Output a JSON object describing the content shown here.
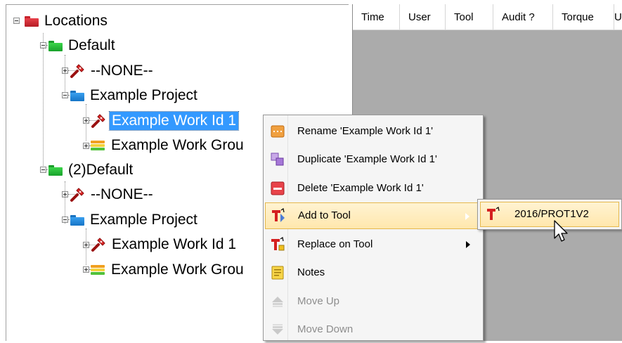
{
  "tree": {
    "root": {
      "label": "Locations",
      "icon": "folder-red"
    },
    "nodes": [
      {
        "label": "Default",
        "icon": "folder-green"
      },
      {
        "label": "--NONE--",
        "icon": "tool-icon"
      },
      {
        "label": "Example Project",
        "icon": "folder-blue"
      },
      {
        "label": "Example Work Id 1",
        "icon": "tool-icon",
        "selected": true
      },
      {
        "label": "Example Work Grou",
        "icon": "work-group-icon"
      },
      {
        "label": "(2)Default",
        "icon": "folder-green"
      },
      {
        "label": "--NONE--",
        "icon": "tool-icon"
      },
      {
        "label": "Example Project",
        "icon": "folder-blue"
      },
      {
        "label": "Example Work Id 1",
        "icon": "tool-icon"
      },
      {
        "label": "Example Work Grou",
        "icon": "work-group-icon"
      }
    ]
  },
  "grid": {
    "columns": [
      "Time",
      "User",
      "Tool",
      "Audit ?",
      "Torque",
      "U"
    ]
  },
  "context_menu": {
    "items": [
      {
        "label": "Rename 'Example Work Id 1'",
        "icon": "rename-icon",
        "state": "normal"
      },
      {
        "label": "Duplicate 'Example Work Id 1'",
        "icon": "duplicate-icon",
        "state": "normal"
      },
      {
        "label": "Delete 'Example Work Id 1'",
        "icon": "delete-icon",
        "state": "normal"
      },
      {
        "label": "Add to Tool",
        "icon": "add-to-tool-icon",
        "state": "highlighted",
        "has_submenu": true
      },
      {
        "label": "Replace on Tool",
        "icon": "replace-on-tool-icon",
        "state": "normal",
        "has_submenu": true
      },
      {
        "label": "Notes",
        "icon": "notes-icon",
        "state": "normal"
      },
      {
        "label": "Move Up",
        "icon": "move-up-icon",
        "state": "disabled"
      },
      {
        "label": "Move Down",
        "icon": "move-down-icon",
        "state": "disabled"
      }
    ]
  },
  "submenu": {
    "items": [
      {
        "label": "2016/PROT1V2",
        "icon": "tool-device-icon",
        "state": "highlighted"
      }
    ]
  },
  "colors": {
    "selection": "#3399ff",
    "menu_highlight": "#ffe7ad",
    "grid_background": "#ababab"
  }
}
